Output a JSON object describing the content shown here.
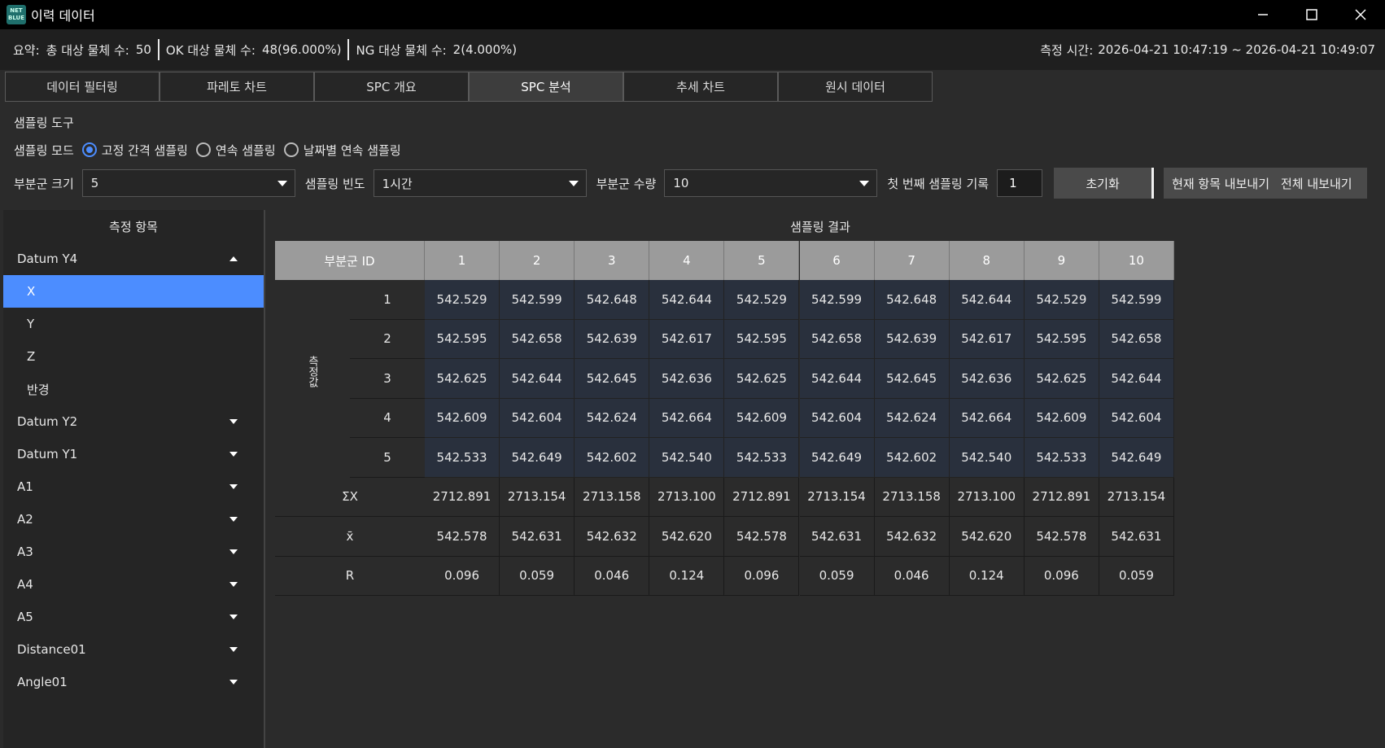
{
  "window": {
    "title": "이력 데이터",
    "logo_text": "NET\nBLUE"
  },
  "summary": {
    "prefix": "요약:",
    "total_label": "총 대상 물체 수:",
    "total_value": "50",
    "ok_label": "OK 대상 물체 수:",
    "ok_value": "48(96.000%)",
    "ng_label": "NG 대상 물체 수:",
    "ng_value": "2(4.000%)",
    "time_label": "측정 시간:",
    "time_value": "2026-04-21 10:47:19 ~ 2026-04-21 10:49:07"
  },
  "tabs": [
    "데이터 필터링",
    "파레토 차트",
    "SPC 개요",
    "SPC 분석",
    "추세 차트",
    "원시 데이터"
  ],
  "active_tab": 3,
  "sampling": {
    "title": "샘플링 도구",
    "mode_label": "샘플링 모드",
    "modes": [
      "고정 간격 샘플링",
      "연속 샘플링",
      "날짜별 연속 샘플링"
    ],
    "selected_mode": 0,
    "subgroup_size_label": "부분군 크기",
    "subgroup_size_value": "5",
    "frequency_label": "샘플링 빈도",
    "frequency_value": "1시간",
    "subgroup_count_label": "부분군 수량",
    "subgroup_count_value": "10",
    "first_record_label": "첫 번째 샘플링 기록",
    "first_record_value": "1",
    "reset_label": "초기화",
    "export_current_label": "현재 항목 내보내기",
    "export_all_label": "전체 내보내기"
  },
  "left_panel": {
    "title": "측정 항목",
    "items": [
      {
        "label": "Datum Y4",
        "level": 0,
        "expanded": true
      },
      {
        "label": "X",
        "level": 1,
        "selected": true
      },
      {
        "label": "Y",
        "level": 1
      },
      {
        "label": "Z",
        "level": 1
      },
      {
        "label": "반경",
        "level": 1
      },
      {
        "label": "Datum Y2",
        "level": 0,
        "expanded": false
      },
      {
        "label": "Datum Y1",
        "level": 0,
        "expanded": false
      },
      {
        "label": "A1",
        "level": 0,
        "expanded": false
      },
      {
        "label": "A2",
        "level": 0,
        "expanded": false
      },
      {
        "label": "A3",
        "level": 0,
        "expanded": false
      },
      {
        "label": "A4",
        "level": 0,
        "expanded": false
      },
      {
        "label": "A5",
        "level": 0,
        "expanded": false
      },
      {
        "label": "Distance01",
        "level": 0,
        "expanded": false
      },
      {
        "label": "Angle01",
        "level": 0,
        "expanded": false
      }
    ]
  },
  "results": {
    "title": "샘플링 결과",
    "header_label": "부분군 ID",
    "group_label": "측정값",
    "subgroup_ids": [
      "1",
      "2",
      "3",
      "4",
      "5",
      "6",
      "7",
      "8",
      "9",
      "10"
    ],
    "measurement_rows": [
      {
        "index": "1",
        "values": [
          "542.529",
          "542.599",
          "542.648",
          "542.644",
          "542.529",
          "542.599",
          "542.648",
          "542.644",
          "542.529",
          "542.599"
        ]
      },
      {
        "index": "2",
        "values": [
          "542.595",
          "542.658",
          "542.639",
          "542.617",
          "542.595",
          "542.658",
          "542.639",
          "542.617",
          "542.595",
          "542.658"
        ]
      },
      {
        "index": "3",
        "values": [
          "542.625",
          "542.644",
          "542.645",
          "542.636",
          "542.625",
          "542.644",
          "542.645",
          "542.636",
          "542.625",
          "542.644"
        ]
      },
      {
        "index": "4",
        "values": [
          "542.609",
          "542.604",
          "542.624",
          "542.664",
          "542.609",
          "542.604",
          "542.624",
          "542.664",
          "542.609",
          "542.604"
        ]
      },
      {
        "index": "5",
        "values": [
          "542.533",
          "542.649",
          "542.602",
          "542.540",
          "542.533",
          "542.649",
          "542.602",
          "542.540",
          "542.533",
          "542.649"
        ]
      }
    ],
    "stat_rows": [
      {
        "label": "ΣX",
        "values": [
          "2712.891",
          "2713.154",
          "2713.158",
          "2713.100",
          "2712.891",
          "2713.154",
          "2713.158",
          "2713.100",
          "2712.891",
          "2713.154"
        ]
      },
      {
        "label": "x̄",
        "values": [
          "542.578",
          "542.631",
          "542.632",
          "542.620",
          "542.578",
          "542.631",
          "542.632",
          "542.620",
          "542.578",
          "542.631"
        ]
      },
      {
        "label": "R",
        "values": [
          "0.096",
          "0.059",
          "0.046",
          "0.124",
          "0.096",
          "0.059",
          "0.046",
          "0.124",
          "0.096",
          "0.059"
        ]
      }
    ]
  }
}
